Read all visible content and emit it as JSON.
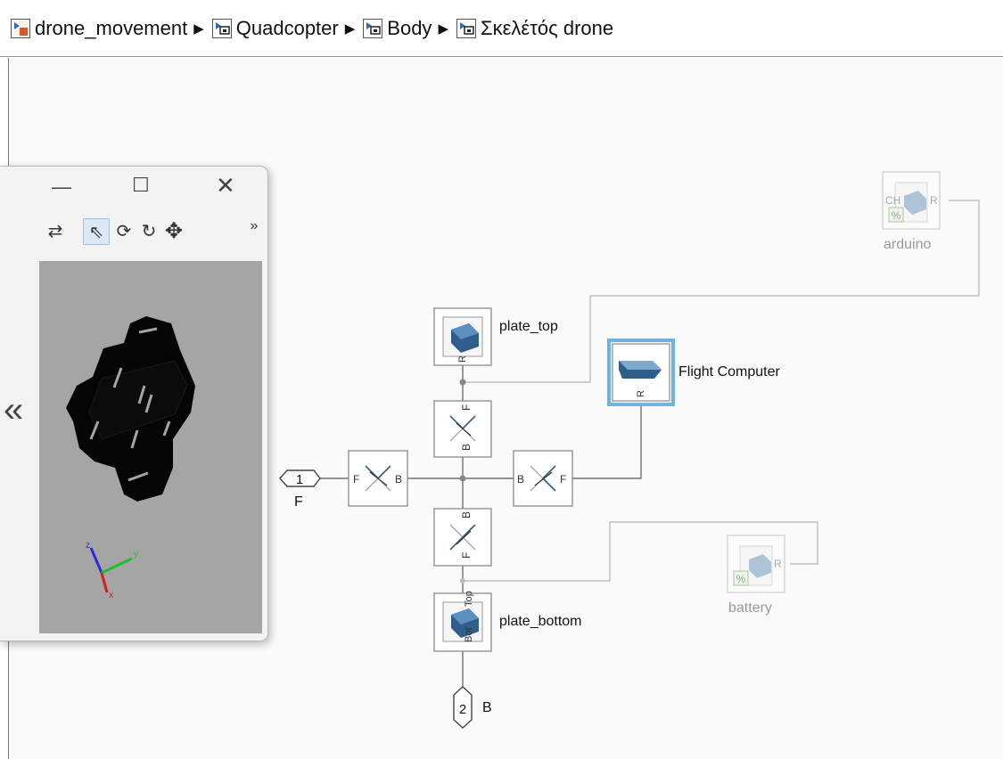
{
  "breadcrumb": [
    {
      "label": "drone_movement",
      "icon": "model-icon"
    },
    {
      "label": "Quadcopter",
      "icon": "subsystem-icon"
    },
    {
      "label": "Body",
      "icon": "subsystem-icon"
    },
    {
      "label": "Σκελέτός drone",
      "icon": "subsystem-icon"
    }
  ],
  "blocks": {
    "plate_top": "plate_top",
    "flight_computer": "Flight Computer",
    "arduino": "arduino",
    "battery": "battery",
    "plate_bottom": "plate_bottom",
    "inport_number": "1",
    "inport_label": "F",
    "outport_number": "2",
    "outport_label": "B"
  },
  "ports": {
    "r": "R",
    "f": "F",
    "b": "B",
    "ch": "CH",
    "percent": "%",
    "top": "Top",
    "bot": "Bot"
  },
  "viewer": {
    "axis_x": "x",
    "axis_y": "y",
    "axis_z": "z",
    "overflow": "»",
    "expand": "«"
  },
  "colors": {
    "selection": "#6ab5e8",
    "block_border": "#8a8a8a",
    "line": "#707070",
    "render_bg": "#a5a5a5"
  }
}
